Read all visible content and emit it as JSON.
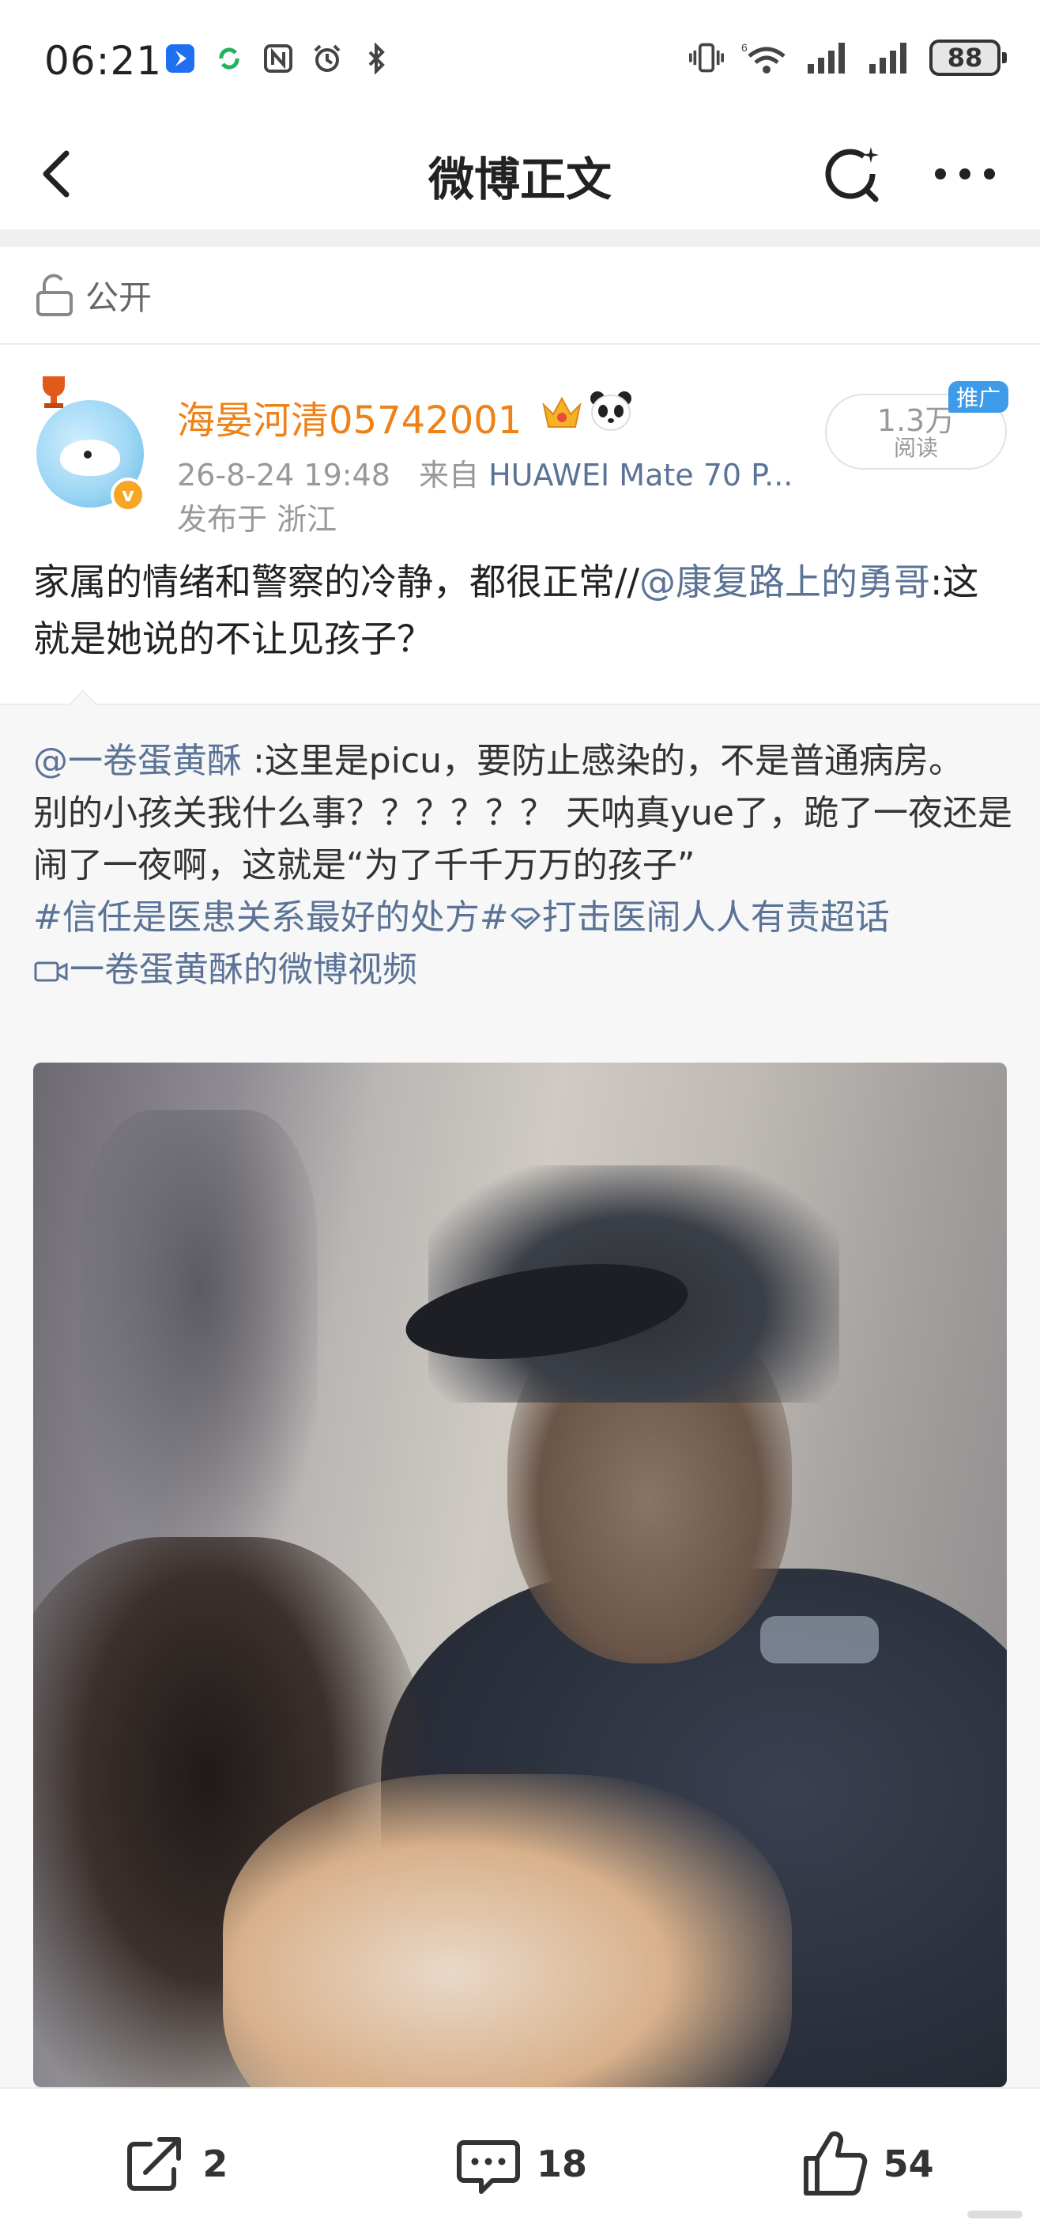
{
  "status_bar": {
    "time": "06:21",
    "left_icons": [
      "app-notification-icon",
      "sync-icon",
      "nfc-icon",
      "alarm-icon",
      "bluetooth-icon"
    ],
    "right_icons": [
      "vibrate-icon",
      "wifi-icon",
      "signal-icon",
      "signal-icon"
    ],
    "wifi_tag": "6",
    "battery": "88"
  },
  "nav": {
    "title": "微博正文"
  },
  "visibility": {
    "label": "公开"
  },
  "author": {
    "name": "海晏河清05742001",
    "time": "26-8-24 19:48",
    "source_prefix": "来自",
    "device": "HUAWEI Mate 70 P...",
    "location": "发布于 浙江",
    "reads": "1.3万",
    "reads_label": "阅读",
    "promo": "推广",
    "verified": "v"
  },
  "post": {
    "text": "家属的情绪和警察的冷静，都很正常//",
    "mention": "@康复路上的勇哥",
    "text_after": ":这就是她说的不让见孩子？"
  },
  "repost": {
    "mention": "@一卷蛋黄酥",
    "line1": " :这里是picu，要防止感染的，不是普通病房。",
    "line2": "别的小孩关我什么事？？？？？？ 天呐真yue了，跪了一夜还是闹了一夜啊，这就是“为了千千万万的孩子”",
    "hashtag1": "#信任是医患关系最好的处方#",
    "hashtag2": "打击医闹人人有责超话",
    "video_link": "一卷蛋黄酥的微博视频"
  },
  "actions": {
    "repost_count": "2",
    "comment_count": "18",
    "like_count": "54"
  },
  "colors": {
    "author_name": "#ee8216",
    "link": "#5a7396",
    "promo_badge": "#3d9be9"
  }
}
